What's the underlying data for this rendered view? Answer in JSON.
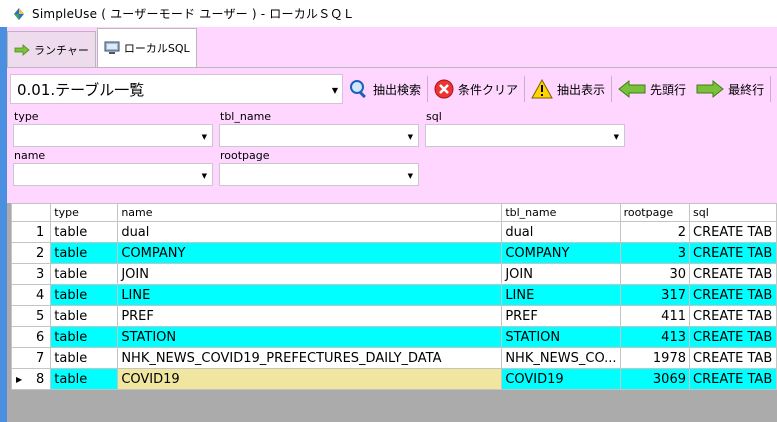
{
  "window": {
    "title": "SimpleUse ( ユーザーモード ユーザー ) - ローカルＳＱＬ"
  },
  "tabs": [
    {
      "label": "ランチャー",
      "icon": "arrow-right-icon"
    },
    {
      "label": "ローカルSQL",
      "icon": "computer-icon",
      "active": true
    }
  ],
  "toolbar": {
    "query_select": "0.01.テーブル一覧",
    "search_label": "抽出検索",
    "clear_label": "条件クリア",
    "show_label": "抽出表示",
    "first_label": "先頭行",
    "last_label": "最終行"
  },
  "filters": {
    "type_label": "type",
    "tbl_name_label": "tbl_name",
    "sql_label": "sql",
    "name_label": "name",
    "rootpage_label": "rootpage"
  },
  "grid": {
    "columns": [
      "type",
      "name",
      "tbl_name",
      "rootpage",
      "sql"
    ],
    "rows": [
      {
        "n": "1",
        "type": "table",
        "name": "dual",
        "tbl_name": "dual",
        "rootpage": "2",
        "sql": "CREATE TAB"
      },
      {
        "n": "2",
        "type": "table",
        "name": "COMPANY",
        "tbl_name": "COMPANY",
        "rootpage": "3",
        "sql": "CREATE TAB"
      },
      {
        "n": "3",
        "type": "table",
        "name": "JOIN",
        "tbl_name": "JOIN",
        "rootpage": "30",
        "sql": "CREATE TAB"
      },
      {
        "n": "4",
        "type": "table",
        "name": "LINE",
        "tbl_name": "LINE",
        "rootpage": "317",
        "sql": "CREATE TAB"
      },
      {
        "n": "5",
        "type": "table",
        "name": "PREF",
        "tbl_name": "PREF",
        "rootpage": "411",
        "sql": "CREATE TAB"
      },
      {
        "n": "6",
        "type": "table",
        "name": "STATION",
        "tbl_name": "STATION",
        "rootpage": "413",
        "sql": "CREATE TAB"
      },
      {
        "n": "7",
        "type": "table",
        "name": "NHK_NEWS_COVID19_PREFECTURES_DAILY_DATA",
        "tbl_name": "NHK_NEWS_CO...",
        "rootpage": "1978",
        "sql": "CREATE TAB"
      },
      {
        "n": "8",
        "type": "table",
        "name": "COVID19",
        "tbl_name": "COVID19",
        "rootpage": "3069",
        "sql": "CREATE TAB"
      }
    ]
  },
  "colors": {
    "cyan_row": "#00ffff",
    "pink_panel": "#ffd6ff",
    "selected_cell": "#f0e6a0",
    "frame": "#4a8fe0"
  }
}
